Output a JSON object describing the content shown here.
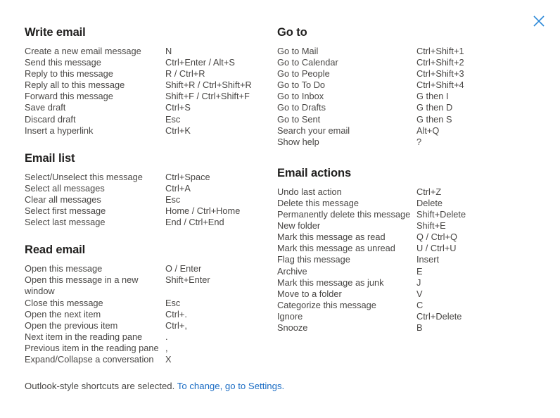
{
  "dialog": {
    "close_icon": "close-icon"
  },
  "columns": {
    "left": [
      {
        "title": "Write email",
        "rows": [
          {
            "desc": "Create a new email message",
            "keys": "N"
          },
          {
            "desc": "Send this message",
            "keys": "Ctrl+Enter / Alt+S"
          },
          {
            "desc": "Reply to this message",
            "keys": "R / Ctrl+R"
          },
          {
            "desc": "Reply all to this message",
            "keys": "Shift+R / Ctrl+Shift+R"
          },
          {
            "desc": "Forward this message",
            "keys": "Shift+F / Ctrl+Shift+F"
          },
          {
            "desc": "Save draft",
            "keys": "Ctrl+S"
          },
          {
            "desc": "Discard draft",
            "keys": "Esc"
          },
          {
            "desc": "Insert a hyperlink",
            "keys": "Ctrl+K"
          }
        ]
      },
      {
        "title": "Email list",
        "rows": [
          {
            "desc": "Select/Unselect this message",
            "keys": "Ctrl+Space"
          },
          {
            "desc": "Select all messages",
            "keys": "Ctrl+A"
          },
          {
            "desc": "Clear all messages",
            "keys": "Esc"
          },
          {
            "desc": "Select first message",
            "keys": "Home / Ctrl+Home"
          },
          {
            "desc": "Select last message",
            "keys": "End / Ctrl+End"
          }
        ]
      },
      {
        "title": "Read email",
        "rows": [
          {
            "desc": "Open this message",
            "keys": "O / Enter"
          },
          {
            "desc": "Open this message in a new window",
            "keys": "Shift+Enter"
          },
          {
            "desc": "Close this message",
            "keys": "Esc"
          },
          {
            "desc": "Open the next item",
            "keys": "Ctrl+."
          },
          {
            "desc": "Open the previous item",
            "keys": "Ctrl+,"
          },
          {
            "desc": "Next item in the reading pane",
            "keys": "."
          },
          {
            "desc": "Previous item in the reading pane",
            "keys": ","
          },
          {
            "desc": "Expand/Collapse a conversation",
            "keys": "X"
          }
        ]
      }
    ],
    "right": [
      {
        "title": "Go to",
        "rows": [
          {
            "desc": "Go to Mail",
            "keys": "Ctrl+Shift+1"
          },
          {
            "desc": "Go to Calendar",
            "keys": "Ctrl+Shift+2"
          },
          {
            "desc": "Go to People",
            "keys": "Ctrl+Shift+3"
          },
          {
            "desc": "Go to To Do",
            "keys": "Ctrl+Shift+4"
          },
          {
            "desc": "Go to Inbox",
            "keys": "G then I"
          },
          {
            "desc": "Go to Drafts",
            "keys": "G then D"
          },
          {
            "desc": "Go to Sent",
            "keys": "G then S"
          },
          {
            "desc": "Search your email",
            "keys": "Alt+Q"
          },
          {
            "desc": "Show help",
            "keys": "?"
          }
        ]
      },
      {
        "title": "Email actions",
        "rows": [
          {
            "desc": "Undo last action",
            "keys": "Ctrl+Z"
          },
          {
            "desc": "Delete this message",
            "keys": "Delete"
          },
          {
            "desc": "Permanently delete this message",
            "keys": "Shift+Delete"
          },
          {
            "desc": "New folder",
            "keys": "Shift+E"
          },
          {
            "desc": "Mark this message as read",
            "keys": "Q / Ctrl+Q"
          },
          {
            "desc": "Mark this message as unread",
            "keys": "U / Ctrl+U"
          },
          {
            "desc": "Flag this message",
            "keys": "Insert"
          },
          {
            "desc": "Archive",
            "keys": "E"
          },
          {
            "desc": "Mark this message as junk",
            "keys": "J"
          },
          {
            "desc": "Move to a folder",
            "keys": "V"
          },
          {
            "desc": "Categorize this message",
            "keys": "C"
          },
          {
            "desc": "Ignore",
            "keys": "Ctrl+Delete"
          },
          {
            "desc": "Snooze",
            "keys": "B"
          }
        ]
      }
    ]
  },
  "footer": {
    "text": "Outlook-style shortcuts are selected.",
    "link_text": "To change, go to Settings."
  },
  "colors": {
    "link": "#1a6cc4",
    "close_icon": "#2b88d8",
    "heading": "#201f1e",
    "body_text": "#484644",
    "background": "#ffffff"
  }
}
